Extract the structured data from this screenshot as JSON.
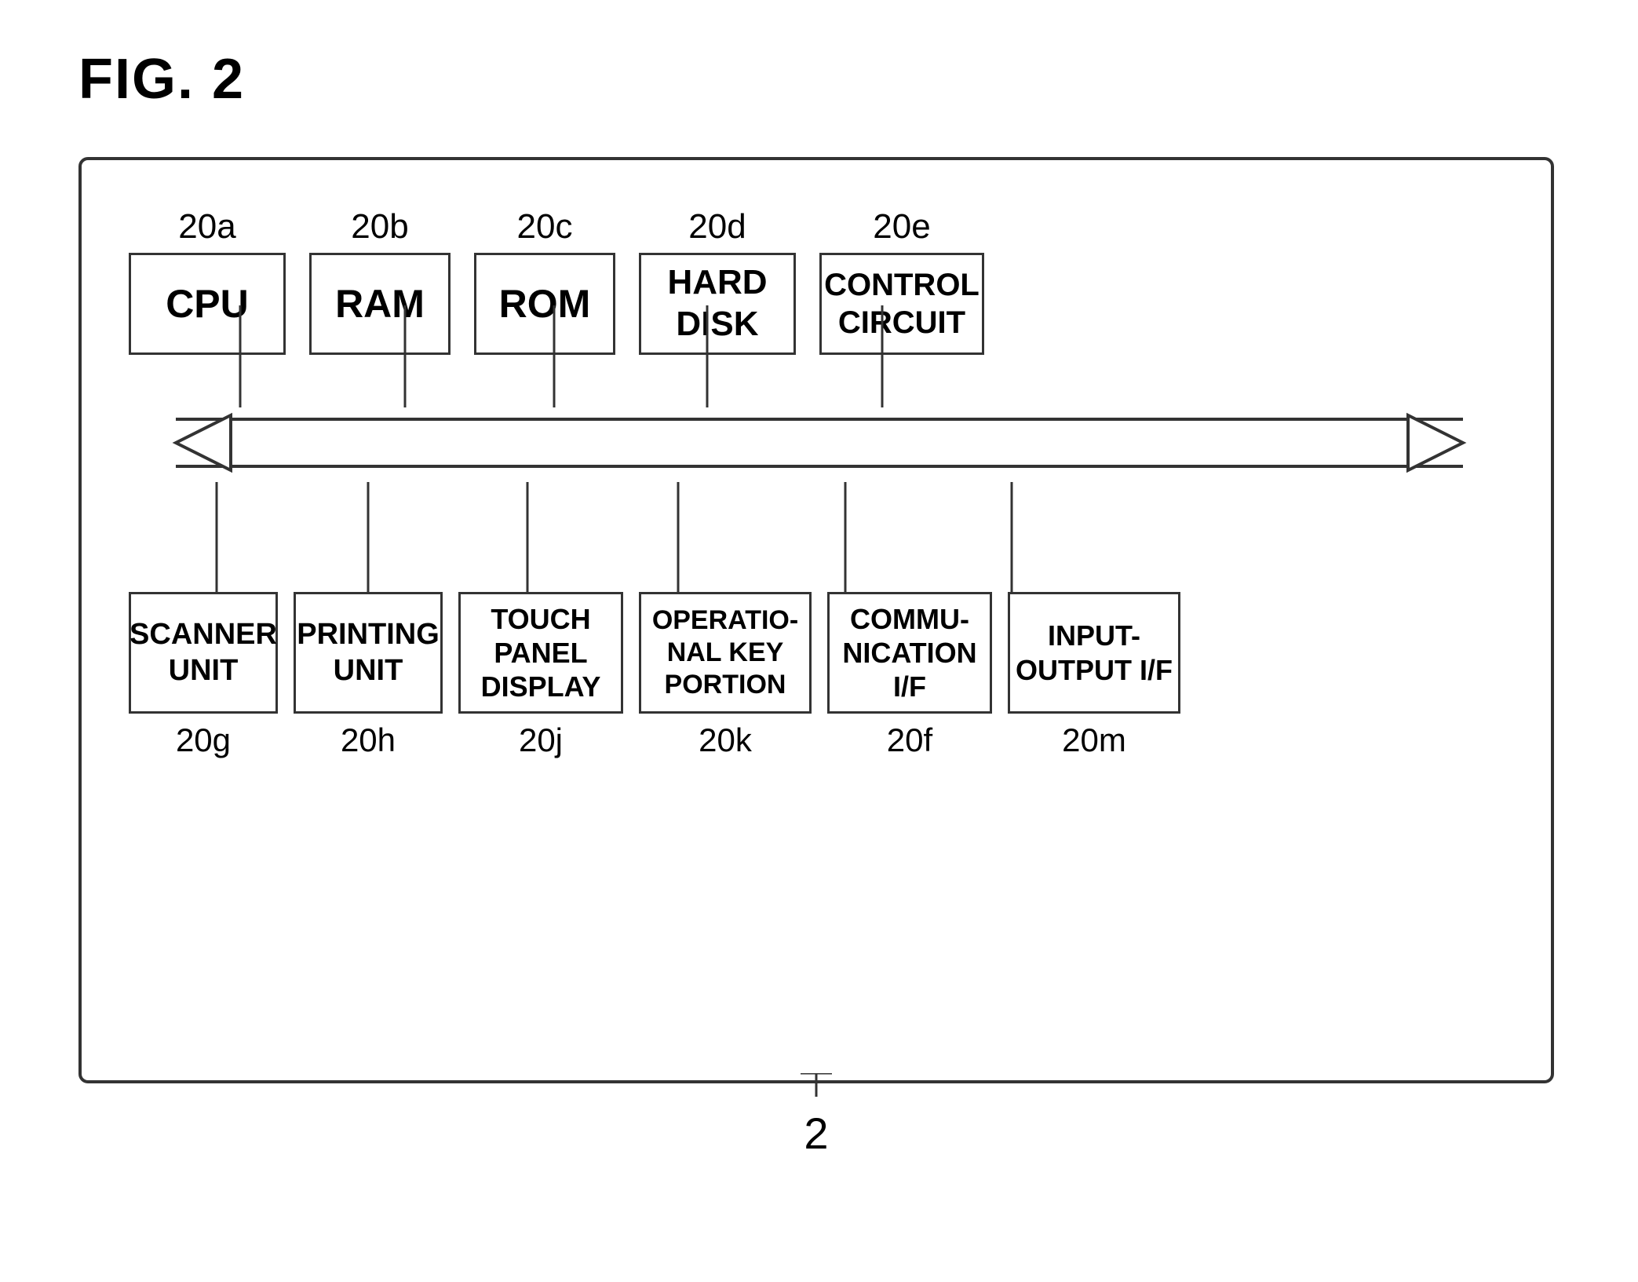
{
  "figure": {
    "label": "FIG. 2"
  },
  "device": {
    "label": "2"
  },
  "top_components": [
    {
      "id": "20a",
      "label": "CPU",
      "ref": "20a"
    },
    {
      "id": "20b",
      "label": "RAM",
      "ref": "20b"
    },
    {
      "id": "20c",
      "label": "ROM",
      "ref": "20c"
    },
    {
      "id": "20d",
      "label": "HARD\nDISK",
      "ref": "20d"
    },
    {
      "id": "20e",
      "label": "CONTROL\nCIRCUIT",
      "ref": "20e"
    }
  ],
  "bottom_components": [
    {
      "id": "20g",
      "label": "SCANNER\nUNIT",
      "ref": "20g"
    },
    {
      "id": "20h",
      "label": "PRINTING\nUNIT",
      "ref": "20h"
    },
    {
      "id": "20j",
      "label": "TOUCH\nPANEL\nDISPLAY",
      "ref": "20j"
    },
    {
      "id": "20k",
      "label": "OPERATIO-\nNAL KEY\nPORTION",
      "ref": "20k"
    },
    {
      "id": "20f",
      "label": "COMMU-\nNICATION\nI/F",
      "ref": "20f"
    },
    {
      "id": "20m",
      "label": "INPUT-\nOUTPUT I/F",
      "ref": "20m"
    }
  ]
}
